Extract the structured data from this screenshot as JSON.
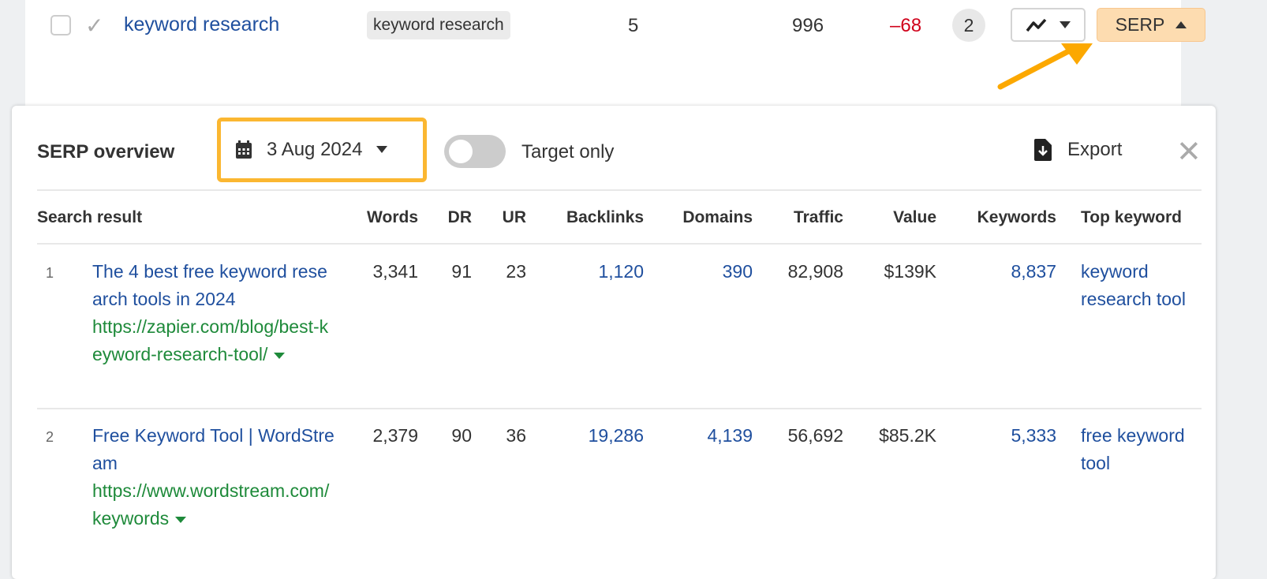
{
  "keyword_row": {
    "keyword": "keyword research",
    "tag": "keyword research",
    "position": "5",
    "volume": "996",
    "change": "–68",
    "badge": "2",
    "serp_label": "SERP"
  },
  "panel": {
    "title": "SERP overview",
    "date": "3 Aug 2024",
    "toggle_label": "Target only",
    "toggle_on": false,
    "export_label": "Export"
  },
  "columns": [
    "Search result",
    "Words",
    "DR",
    "UR",
    "Backlinks",
    "Domains",
    "Traffic",
    "Value",
    "Keywords",
    "Top keyword"
  ],
  "rows": [
    {
      "rank": "1",
      "title": "The 4 best free keyword research tools in 2024",
      "url": "https://zapier.com/blog/best-keyword-research-tool/",
      "words": "3,341",
      "dr": "91",
      "ur": "23",
      "backlinks": "1,120",
      "domains": "390",
      "traffic": "82,908",
      "value": "$139K",
      "keywords": "8,837",
      "top_keyword": "keyword research tool"
    },
    {
      "rank": "2",
      "title": "Free Keyword Tool | WordStream",
      "url": "https://www.wordstream.com/keywords",
      "words": "2,379",
      "dr": "90",
      "ur": "36",
      "backlinks": "19,286",
      "domains": "4,139",
      "traffic": "56,692",
      "value": "$85.2K",
      "keywords": "5,333",
      "top_keyword": "free keyword tool"
    }
  ],
  "colors": {
    "accent": "#fbb731",
    "link": "#1f4f9e",
    "url": "#1e8a3a",
    "negative": "#d0021b",
    "serp_button": "#fddcb0"
  }
}
